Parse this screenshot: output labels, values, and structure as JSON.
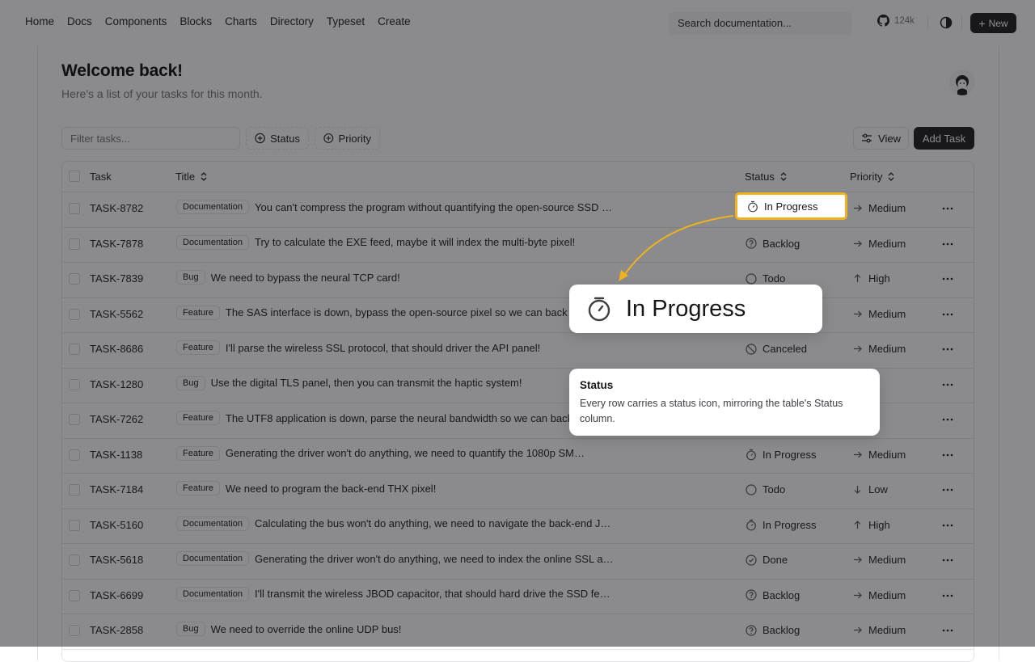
{
  "nav": {
    "links": [
      "Home",
      "Docs",
      "Components",
      "Blocks",
      "Charts",
      "Directory",
      "Typeset",
      "Create"
    ],
    "search_placeholder": "Search documentation...",
    "github_stars": "124k",
    "new_label": "New"
  },
  "page": {
    "title": "Welcome back!",
    "subtitle": "Here's a list of your tasks for this month."
  },
  "toolbar": {
    "filter_placeholder": "Filter tasks...",
    "status_label": "Status",
    "priority_label": "Priority",
    "view_label": "View",
    "add_label": "Add Task"
  },
  "table": {
    "headers": {
      "task": "Task",
      "title": "Title",
      "status": "Status",
      "priority": "Priority"
    },
    "rows": [
      {
        "id": "TASK-8782",
        "label": "Documentation",
        "title": "You can't compress the program without quantifying the open-source SSD …",
        "status": "In Progress",
        "status_icon": "timer-icon",
        "priority": "Medium",
        "priority_icon": "arrow-right-icon"
      },
      {
        "id": "TASK-7878",
        "label": "Documentation",
        "title": "Try to calculate the EXE feed, maybe it will index the multi-byte pixel!",
        "status": "Backlog",
        "status_icon": "help-circle-icon",
        "priority": "Medium",
        "priority_icon": "arrow-right-icon"
      },
      {
        "id": "TASK-7839",
        "label": "Bug",
        "title": "We need to bypass the neural TCP card!",
        "status": "Todo",
        "status_icon": "circle-icon",
        "priority": "High",
        "priority_icon": "arrow-up-icon"
      },
      {
        "id": "TASK-5562",
        "label": "Feature",
        "title": "The SAS interface is down, bypass the open-source pixel so we can back",
        "status": "",
        "status_icon": "",
        "priority": "Medium",
        "priority_icon": "arrow-right-icon"
      },
      {
        "id": "TASK-8686",
        "label": "Feature",
        "title": "I'll parse the wireless SSL protocol, that should driver the API panel!",
        "status": "Canceled",
        "status_icon": "circle-off-icon",
        "priority": "Medium",
        "priority_icon": "arrow-right-icon"
      },
      {
        "id": "TASK-1280",
        "label": "Bug",
        "title": "Use the digital TLS panel, then you can transmit the haptic system!",
        "status": "",
        "status_icon": "",
        "priority": "igh",
        "priority_icon": ""
      },
      {
        "id": "TASK-7262",
        "label": "Feature",
        "title": "The UTF8 application is down, parse the neural bandwidth so we can back",
        "status": "",
        "status_icon": "",
        "priority": "igh",
        "priority_icon": ""
      },
      {
        "id": "TASK-1138",
        "label": "Feature",
        "title": "Generating the driver won't do anything, we need to quantify the 1080p SM…",
        "status": "In Progress",
        "status_icon": "timer-icon",
        "priority": "Medium",
        "priority_icon": "arrow-right-icon"
      },
      {
        "id": "TASK-7184",
        "label": "Feature",
        "title": "We need to program the back-end THX pixel!",
        "status": "Todo",
        "status_icon": "circle-icon",
        "priority": "Low",
        "priority_icon": "arrow-down-icon"
      },
      {
        "id": "TASK-5160",
        "label": "Documentation",
        "title": "Calculating the bus won't do anything, we need to navigate the back-end J…",
        "status": "In Progress",
        "status_icon": "timer-icon",
        "priority": "High",
        "priority_icon": "arrow-up-icon"
      },
      {
        "id": "TASK-5618",
        "label": "Documentation",
        "title": "Generating the driver won't do anything, we need to index the online SSL a…",
        "status": "Done",
        "status_icon": "check-circle-icon",
        "priority": "Medium",
        "priority_icon": "arrow-right-icon"
      },
      {
        "id": "TASK-6699",
        "label": "Documentation",
        "title": "I'll transmit the wireless JBOD capacitor, that should hard drive the SSD fe…",
        "status": "Backlog",
        "status_icon": "help-circle-icon",
        "priority": "Medium",
        "priority_icon": "arrow-right-icon"
      },
      {
        "id": "TASK-2858",
        "label": "Bug",
        "title": "We need to override the online UDP bus!",
        "status": "Backlog",
        "status_icon": "help-circle-icon",
        "priority": "Medium",
        "priority_icon": "arrow-right-icon"
      }
    ]
  },
  "callout": {
    "highlight_label": "In Progress",
    "zoom_label": "In Progress",
    "note_title": "Status",
    "note_body": "Every row carries a status icon, mirroring the table's Status column.",
    "accent": "#f0b21e"
  }
}
